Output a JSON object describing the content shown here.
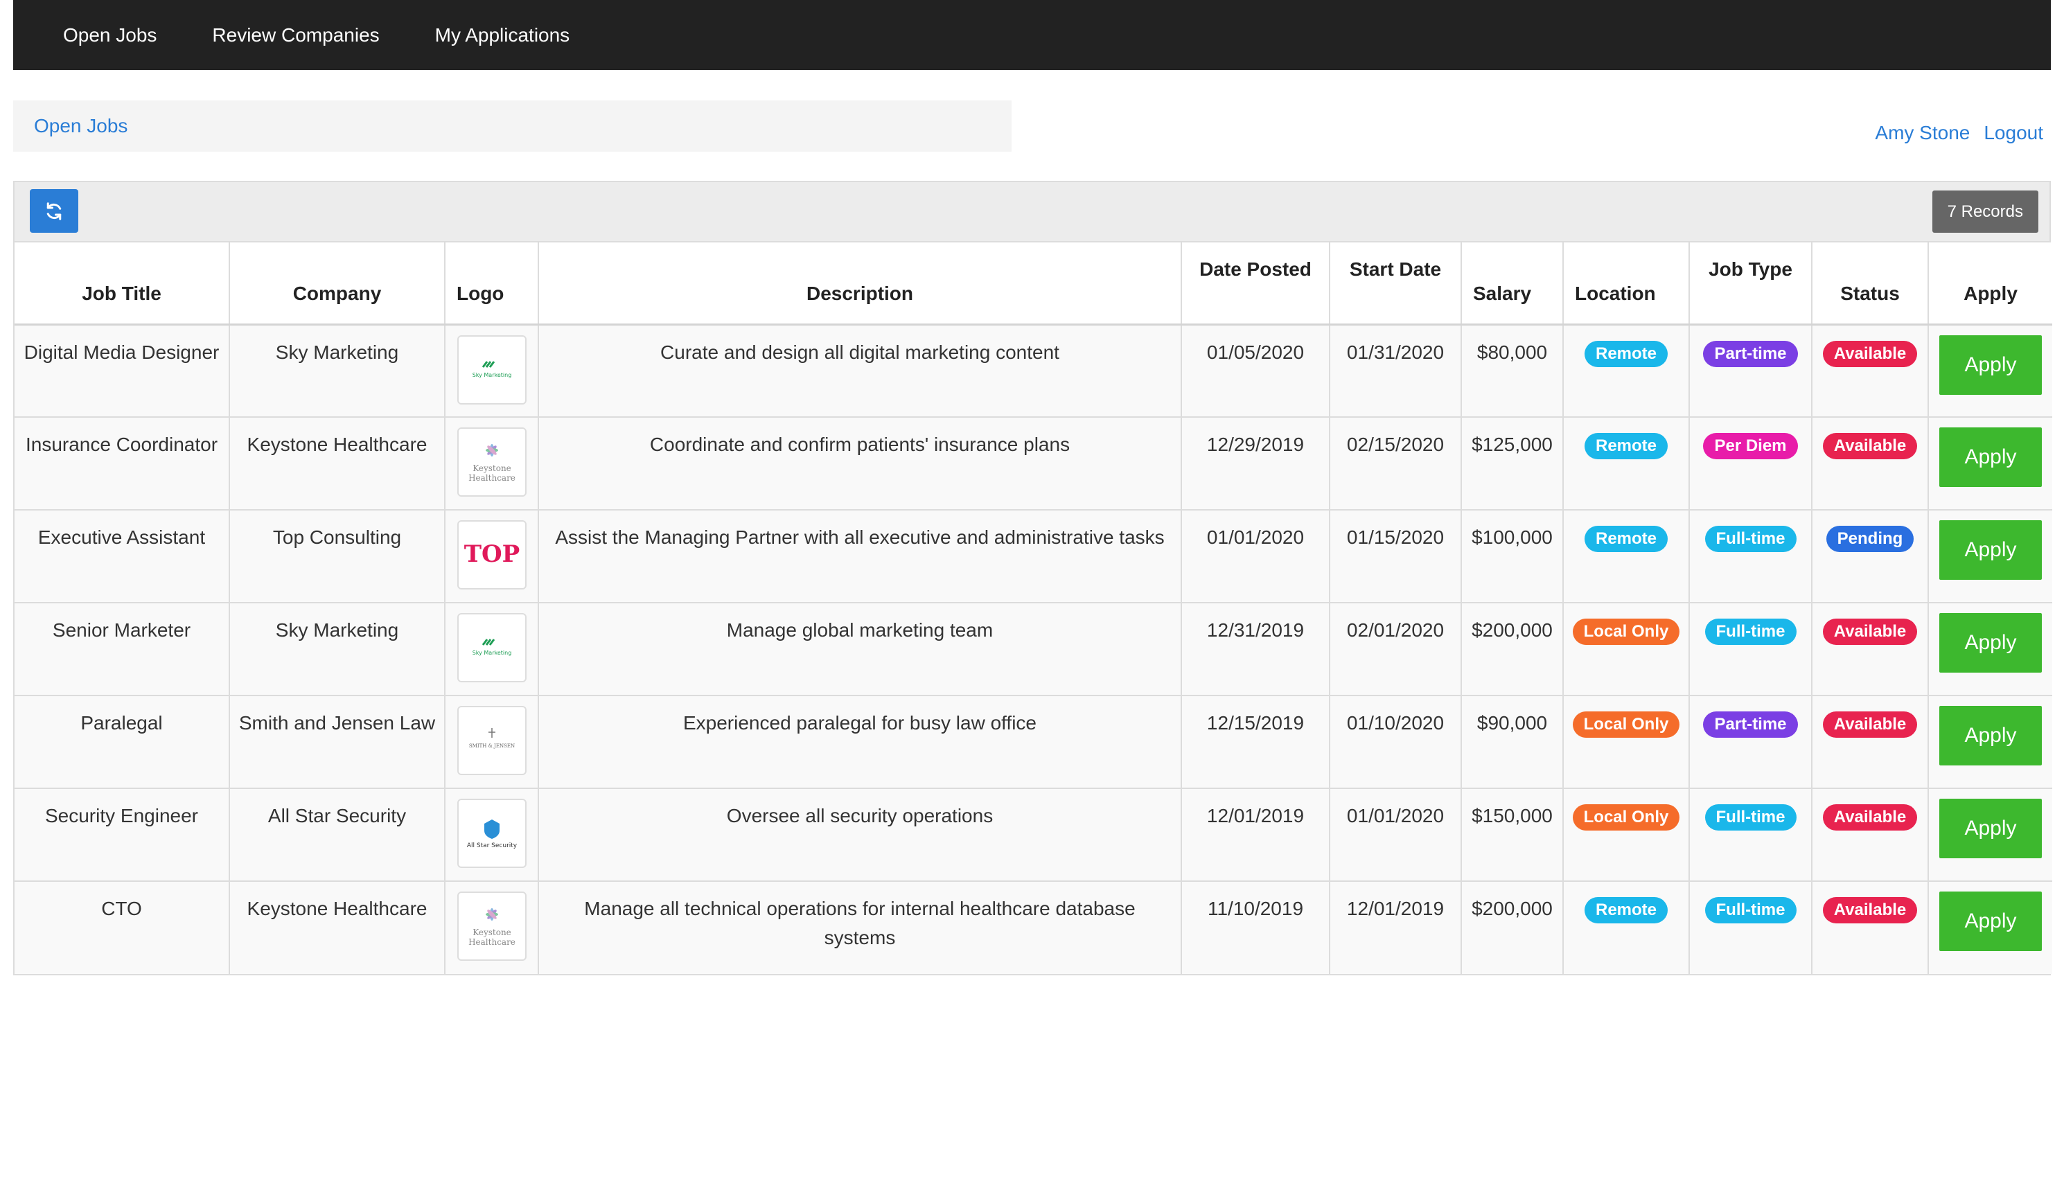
{
  "nav": {
    "items": [
      "Open Jobs",
      "Review Companies",
      "My Applications"
    ]
  },
  "breadcrumb": "Open Jobs",
  "user": {
    "name": "Amy Stone",
    "logout": "Logout"
  },
  "toolbar": {
    "refresh_icon": "refresh-icon",
    "records": "7 Records"
  },
  "colors": {
    "remote": "#1ab7ea",
    "local_only": "#f56c2a",
    "part_time": "#7b3fe4",
    "per_diem": "#e81ca9",
    "full_time": "#1ab7ea",
    "available": "#e8234f",
    "pending": "#2a6fe0",
    "apply": "#3db82e"
  },
  "table": {
    "headers": [
      "Job Title",
      "Company",
      "Logo",
      "Description",
      "Date Posted",
      "Start Date",
      "Salary",
      "Location",
      "Job Type",
      "Status",
      "Apply"
    ],
    "rows": [
      {
        "title": "Digital Media Designer",
        "company": "Sky Marketing",
        "logo": "Sky Marketing",
        "description": "Curate and design all digital marketing content",
        "posted": "01/05/2020",
        "start": "01/31/2020",
        "salary": "$80,000",
        "location": "Remote",
        "location_kind": "remote",
        "job_type": "Part-time",
        "job_type_kind": "part_time",
        "status": "Available",
        "status_kind": "available",
        "apply": "Apply"
      },
      {
        "title": "Insurance Coordinator",
        "company": "Keystone Healthcare",
        "logo": "Keystone Healthcare",
        "description": "Coordinate and confirm patients' insurance plans",
        "posted": "12/29/2019",
        "start": "02/15/2020",
        "salary": "$125,000",
        "location": "Remote",
        "location_kind": "remote",
        "job_type": "Per Diem",
        "job_type_kind": "per_diem",
        "status": "Available",
        "status_kind": "available",
        "apply": "Apply"
      },
      {
        "title": "Executive Assistant",
        "company": "Top Consulting",
        "logo": "TOP",
        "description": "Assist the Managing Partner with all executive and administrative tasks",
        "posted": "01/01/2020",
        "start": "01/15/2020",
        "salary": "$100,000",
        "location": "Remote",
        "location_kind": "remote",
        "job_type": "Full-time",
        "job_type_kind": "full_time",
        "status": "Pending",
        "status_kind": "pending",
        "apply": "Apply"
      },
      {
        "title": "Senior Marketer",
        "company": "Sky Marketing",
        "logo": "Sky Marketing",
        "description": "Manage global marketing team",
        "posted": "12/31/2019",
        "start": "02/01/2020",
        "salary": "$200,000",
        "location": "Local Only",
        "location_kind": "local_only",
        "job_type": "Full-time",
        "job_type_kind": "full_time",
        "status": "Available",
        "status_kind": "available",
        "apply": "Apply"
      },
      {
        "title": "Paralegal",
        "company": "Smith and Jensen Law",
        "logo": "SMITH & JENSEN",
        "description": "Experienced paralegal for busy law office",
        "posted": "12/15/2019",
        "start": "01/10/2020",
        "salary": "$90,000",
        "location": "Local Only",
        "location_kind": "local_only",
        "job_type": "Part-time",
        "job_type_kind": "part_time",
        "status": "Available",
        "status_kind": "available",
        "apply": "Apply"
      },
      {
        "title": "Security Engineer",
        "company": "All Star Security",
        "logo": "All Star Security",
        "description": "Oversee all security operations",
        "posted": "12/01/2019",
        "start": "01/01/2020",
        "salary": "$150,000",
        "location": "Local Only",
        "location_kind": "local_only",
        "job_type": "Full-time",
        "job_type_kind": "full_time",
        "status": "Available",
        "status_kind": "available",
        "apply": "Apply"
      },
      {
        "title": "CTO",
        "company": "Keystone Healthcare",
        "logo": "Keystone Healthcare",
        "description": "Manage all technical operations for internal healthcare database systems",
        "posted": "11/10/2019",
        "start": "12/01/2019",
        "salary": "$200,000",
        "location": "Remote",
        "location_kind": "remote",
        "job_type": "Full-time",
        "job_type_kind": "full_time",
        "status": "Available",
        "status_kind": "available",
        "apply": "Apply"
      }
    ]
  }
}
